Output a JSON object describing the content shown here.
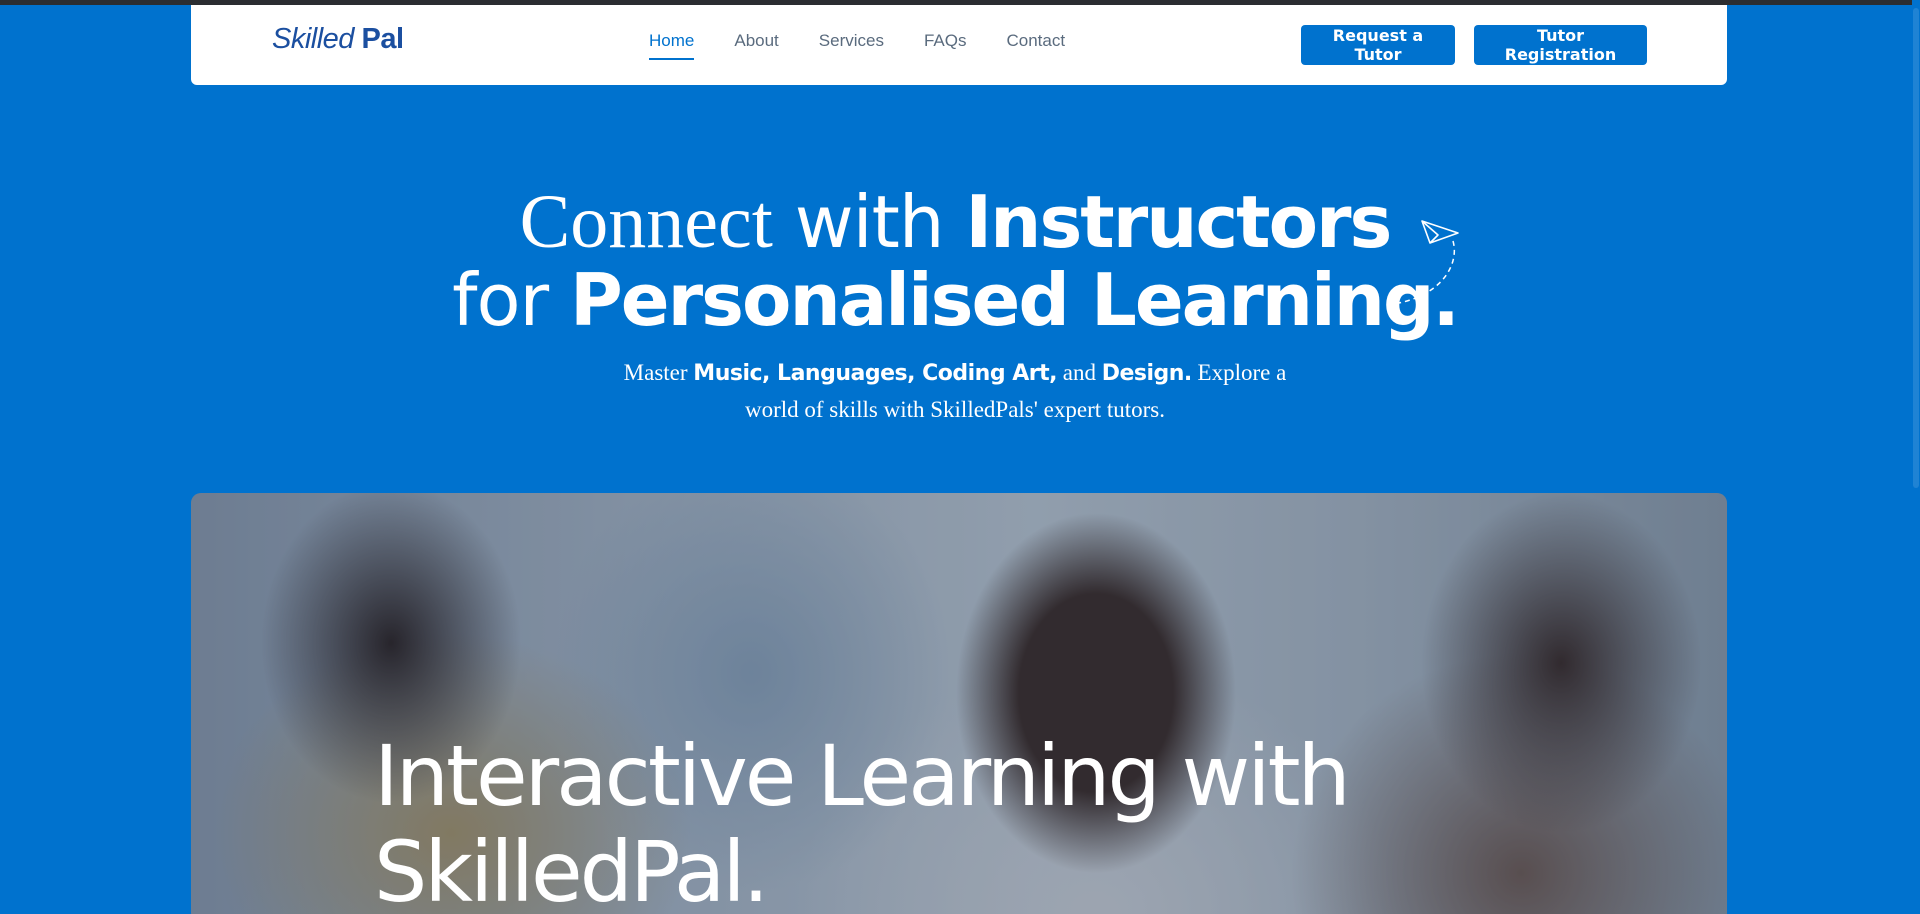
{
  "header": {
    "logo": {
      "part1": "Skilled",
      "part2": "Pal"
    },
    "nav": [
      {
        "label": "Home",
        "active": true
      },
      {
        "label": "About",
        "active": false
      },
      {
        "label": "Services",
        "active": false
      },
      {
        "label": "FAQs",
        "active": false
      },
      {
        "label": "Contact",
        "active": false
      }
    ],
    "request_tutor_label": "Request a Tutor",
    "tutor_registration_label": "Tutor Registration"
  },
  "hero": {
    "line1_a": "Connect",
    "line1_b": " with ",
    "line1_c": "Instructors",
    "line2_a": "for ",
    "line2_b": "Personalised Learning.",
    "sub_a": "Master ",
    "sub_b": "Music, Languages, Coding Art,",
    "sub_c": " and ",
    "sub_d": "Design.",
    "sub_e": " Explore a",
    "sub_f": "world of skills with SkilledPals' expert tutors."
  },
  "card": {
    "title_line1": "Interactive Learning with",
    "title_line2": "SkilledPal."
  },
  "colors": {
    "brand_blue": "#0072CE",
    "logo_blue": "#1b4fa0",
    "white": "#ffffff"
  },
  "icons": {
    "paper_plane": "paper-plane-icon"
  }
}
